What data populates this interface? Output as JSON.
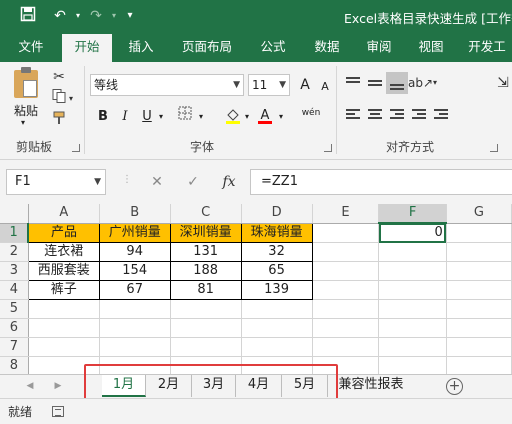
{
  "titlebar": {
    "title": "Excel表格目录快速生成  [工作簿",
    "icons": [
      "save-icon",
      "undo-icon",
      "redo-icon",
      "customize-icon"
    ],
    "bg": "#217346"
  },
  "ribbon_tabs": [
    "文件",
    "开始",
    "插入",
    "页面布局",
    "公式",
    "数据",
    "审阅",
    "视图",
    "开发工"
  ],
  "active_tab": "开始",
  "clipboard": {
    "paste_label": "粘贴",
    "group_label": "剪贴板"
  },
  "font": {
    "name": "等线",
    "size": "11",
    "grow": "A",
    "shrink": "A",
    "bold": "B",
    "italic": "I",
    "underline": "U",
    "phonetic": "wén",
    "group_label": "字体"
  },
  "alignment": {
    "group_label": "对齐方式"
  },
  "formula_bar": {
    "name_box": "F1",
    "cancel": "✕",
    "enter": "✓",
    "fx": "fx",
    "formula": "=ZZ1"
  },
  "grid": {
    "columns": [
      "A",
      "B",
      "C",
      "D",
      "E",
      "F",
      "G"
    ],
    "rows": [
      "1",
      "2",
      "3",
      "4",
      "5",
      "6",
      "7",
      "8"
    ],
    "header_row": [
      "产品",
      "广州销量",
      "深圳销量",
      "珠海销量"
    ],
    "data_rows": [
      [
        "连衣裙",
        "94",
        "131",
        "32"
      ],
      [
        "西服套装",
        "154",
        "188",
        "65"
      ],
      [
        "裤子",
        "67",
        "81",
        "139"
      ]
    ],
    "f1_value": "0",
    "header_fill": "#ffc000",
    "selection_color": "#217346"
  },
  "sheet_tabs": [
    "1月",
    "2月",
    "3月",
    "4月",
    "5月"
  ],
  "active_sheet": "1月",
  "extra_sheet": "兼容性报表",
  "add_sheet": "+",
  "status": {
    "text": "就绪"
  }
}
